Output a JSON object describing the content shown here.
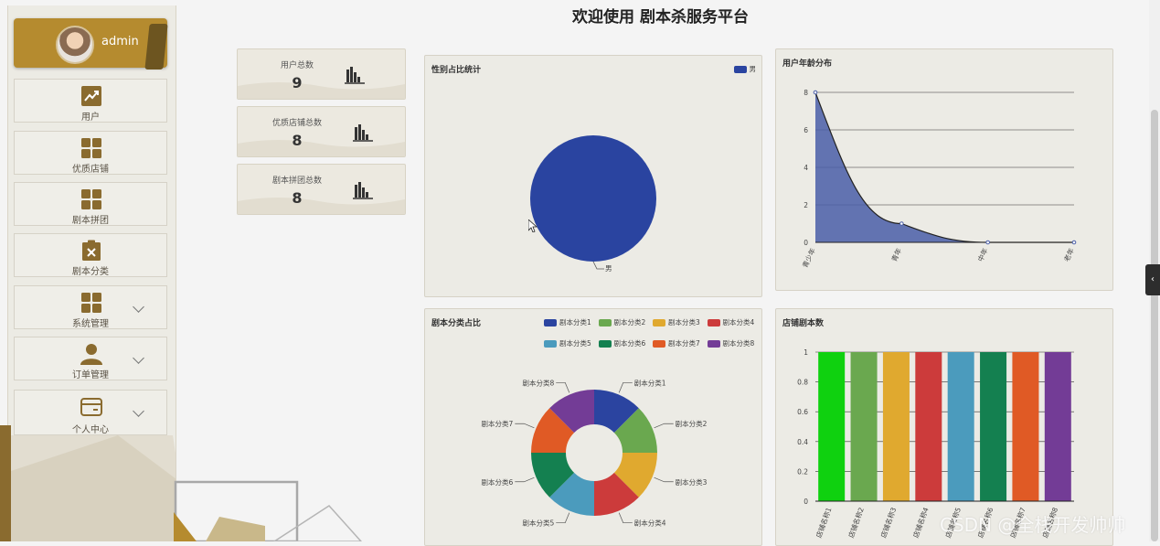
{
  "header": {
    "title": "欢迎使用 剧本杀服务平台"
  },
  "user": {
    "name": "admin"
  },
  "sidebar": {
    "items": [
      {
        "label": "用户",
        "icon": "trend-chart-icon",
        "has_submenu": false
      },
      {
        "label": "优质店铺",
        "icon": "grid-icon",
        "has_submenu": false
      },
      {
        "label": "剧本拼团",
        "icon": "grid-icon",
        "has_submenu": false
      },
      {
        "label": "剧本分类",
        "icon": "clipboard-x-icon",
        "has_submenu": false
      },
      {
        "label": "系统管理",
        "icon": "grid-icon",
        "has_submenu": true
      },
      {
        "label": "订单管理",
        "icon": "person-icon",
        "has_submenu": true
      },
      {
        "label": "个人中心",
        "icon": "card-icon",
        "has_submenu": true
      }
    ]
  },
  "stats": [
    {
      "label": "用户总数",
      "value": "9"
    },
    {
      "label": "优质店铺总数",
      "value": "8"
    },
    {
      "label": "剧本拼团总数",
      "value": "8"
    }
  ],
  "charts": {
    "gender": {
      "title": "性别占比统计",
      "legend": [
        "男"
      ],
      "chart_data": {
        "type": "pie",
        "categories": [
          "男"
        ],
        "values": [
          9
        ],
        "colors": [
          "#2a44a0"
        ]
      }
    },
    "age": {
      "title": "用户年龄分布",
      "chart_data": {
        "type": "area",
        "categories": [
          "青少年",
          "青年",
          "中年",
          "老年"
        ],
        "values": [
          8,
          1,
          0,
          0
        ],
        "ylim": [
          0,
          8
        ],
        "yticks": [
          "0",
          "2",
          "4",
          "6",
          "8"
        ],
        "color": "#4a5ea8"
      }
    },
    "category": {
      "title": "剧本分类占比",
      "chart_data": {
        "type": "pie",
        "donut": true,
        "categories": [
          "剧本分类1",
          "剧本分类2",
          "剧本分类3",
          "剧本分类4",
          "剧本分类5",
          "剧本分类6",
          "剧本分类7",
          "剧本分类8"
        ],
        "values": [
          1,
          1,
          1,
          1,
          1,
          1,
          1,
          1
        ],
        "colors": [
          "#2b44a0",
          "#6aa84f",
          "#e0a92f",
          "#cc3b3b",
          "#4b9bbd",
          "#148050",
          "#e05a25",
          "#733c96"
        ]
      }
    },
    "shop": {
      "title": "店铺剧本数",
      "chart_data": {
        "type": "bar",
        "categories": [
          "店铺名称1",
          "店铺名称2",
          "店铺名称3",
          "店铺名称4",
          "店铺名称5",
          "店铺名称6",
          "店铺名称7",
          "店铺名称8"
        ],
        "values": [
          1,
          1,
          1,
          1,
          1,
          1,
          1,
          1
        ],
        "ylim": [
          0,
          1
        ],
        "yticks": [
          "0",
          "0.2",
          "0.4",
          "0.6",
          "0.8",
          "1"
        ],
        "colors": [
          "#0fd10f",
          "#6aa84f",
          "#e0a92f",
          "#cc3b3b",
          "#4b9bbd",
          "#148050",
          "#e05a25",
          "#733c96"
        ]
      }
    }
  },
  "watermark": "CSDN @全栈开发帅帅"
}
